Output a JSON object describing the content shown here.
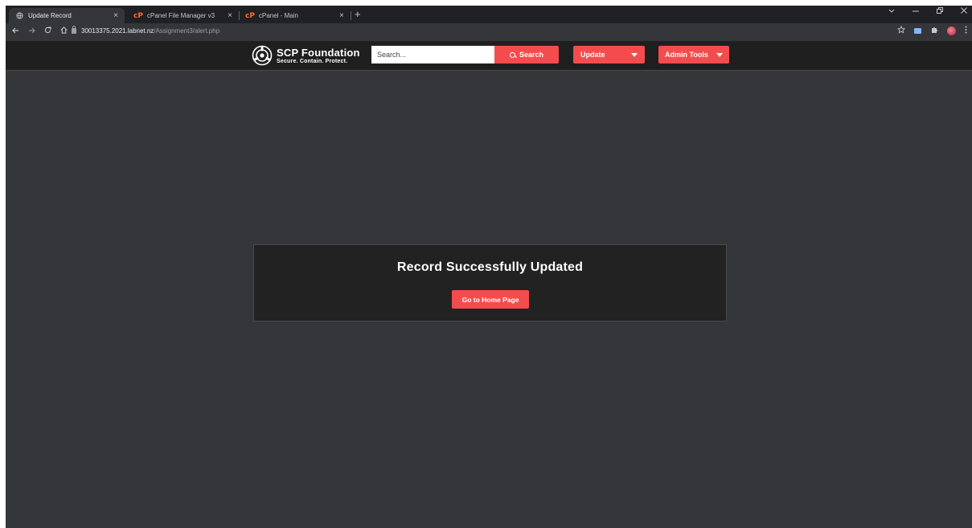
{
  "browser": {
    "tabs": [
      {
        "title": "Update Record",
        "icon": "globe-icon",
        "active": true
      },
      {
        "title": "cPanel File Manager v3",
        "icon": "cpanel-icon",
        "active": false
      },
      {
        "title": "cPanel - Main",
        "icon": "cpanel-icon",
        "active": false
      }
    ],
    "tab_close": "×",
    "new_tab": "+",
    "url_host": "30013375.2021.labnet.nz",
    "url_path": "/Assignment3/alert.php",
    "cpanel_glyph": "cP"
  },
  "site": {
    "logo_name": "SCP Foundation",
    "logo_tagline": "Secure. Contain. Protect.",
    "search": {
      "placeholder": "Search...",
      "button_label": "Search"
    },
    "nav": {
      "update_label": "Update",
      "admin_label": "Admin Tools"
    },
    "accent_color": "#f44c4c",
    "background_color": "#35363a"
  },
  "alert": {
    "message": "Record Successfully Updated",
    "button_label": "Go to Home Page"
  }
}
